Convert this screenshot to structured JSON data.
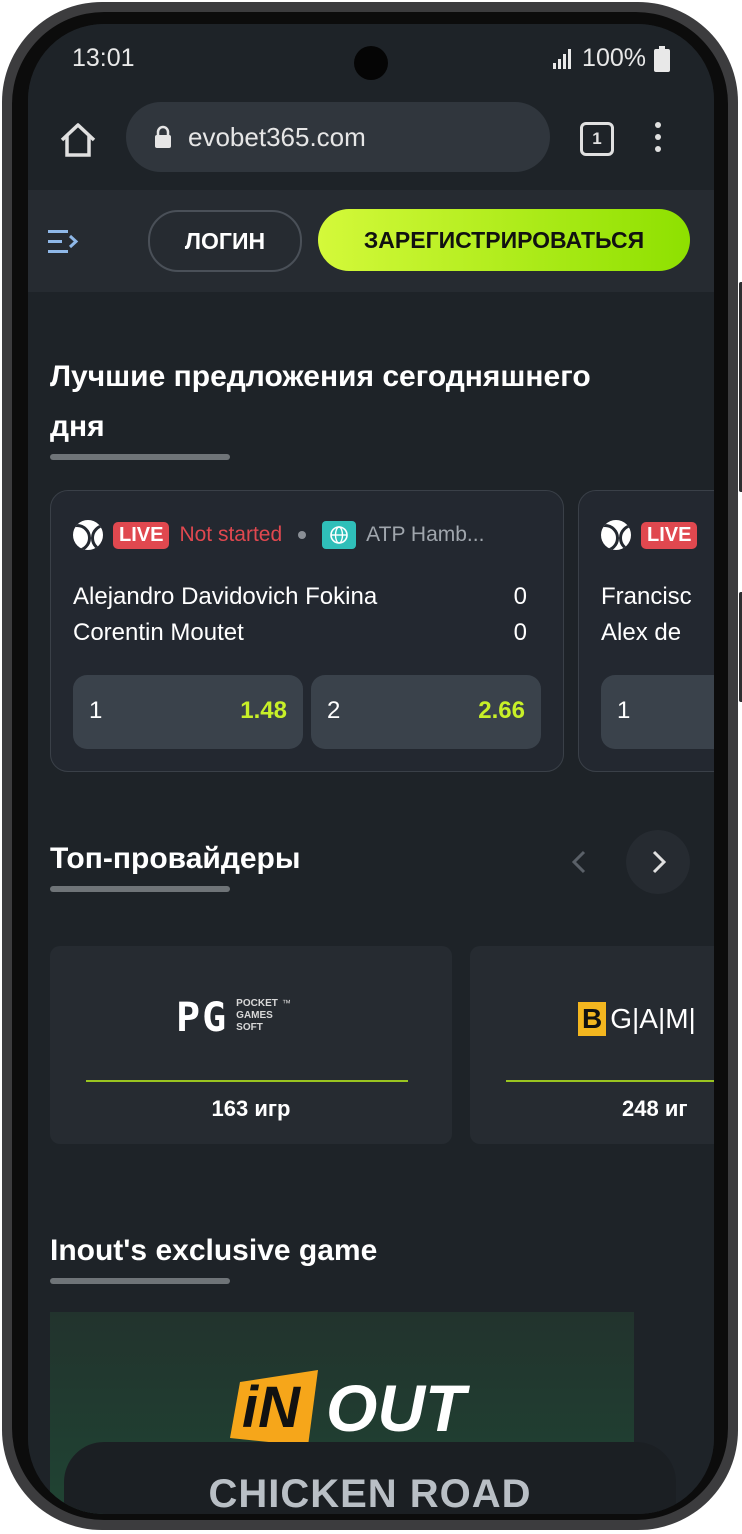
{
  "status_bar": {
    "time": "13:01",
    "battery": "100%"
  },
  "browser": {
    "url": "evobet365.com",
    "tab_count": "1"
  },
  "header": {
    "login_label": "ЛОГИН",
    "register_label": "ЗАРЕГИСТРИРОВАТЬСЯ"
  },
  "offers": {
    "title_line1": "Лучшие предложения сегодняшнего",
    "title_line2": "дня",
    "matches": [
      {
        "live": "LIVE",
        "status": "Not started",
        "league": "ATP Hamb...",
        "team1": "Alejandro Davidovich Fokina",
        "score1": "0",
        "team2": "Corentin Moutet",
        "score2": "0",
        "odd1_label": "1",
        "odd1_value": "1.48",
        "odd2_label": "2",
        "odd2_value": "2.66"
      },
      {
        "live": "LIVE",
        "team1": "Francisc",
        "team2": "Alex de",
        "odd1_label": "1"
      }
    ]
  },
  "providers": {
    "title": "Топ-провайдеры",
    "items": [
      {
        "logo_main": "PG",
        "logo_sub1": "POCKET",
        "logo_sub2": "GAMES",
        "logo_sub3": "SOFT",
        "tm": "™",
        "count": "163 игр"
      },
      {
        "logo_b": "B",
        "logo_rest": "G|A|M|",
        "count": "248 иг"
      }
    ]
  },
  "exclusive": {
    "title": "Inout's exclusive game",
    "brand_i": "iN",
    "brand_out": "OUT",
    "game": "CHICKEN ROAD"
  },
  "colors": {
    "accent": "#c8f028",
    "live": "#e0484f",
    "background": "#1e2328"
  }
}
